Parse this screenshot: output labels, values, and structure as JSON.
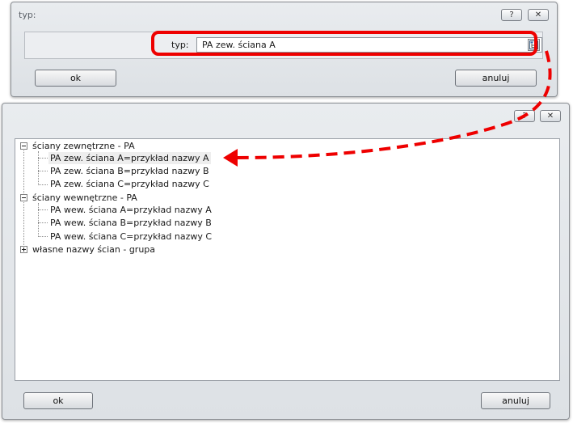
{
  "dialog_type": {
    "title": "typ:",
    "help_glyph": "?",
    "close_glyph": "✕",
    "field_label": "typ:",
    "field_value": "PA zew. ściana A",
    "ok_label": "ok",
    "cancel_label": "anuluj"
  },
  "dialog_tree": {
    "help_glyph": "?",
    "close_glyph": "✕",
    "groups": [
      {
        "label": "ściany zewnętrzne - PA",
        "expanded": true,
        "items": [
          {
            "label": "PA zew. ściana A=przykład nazwy A",
            "selected": true
          },
          {
            "label": "PA zew. ściana B=przykład nazwy B"
          },
          {
            "label": "PA zew. ściana C=przykład nazwy C"
          }
        ]
      },
      {
        "label": "ściany wewnętrzne - PA",
        "expanded": true,
        "items": [
          {
            "label": "PA wew. ściana A=przykład nazwy A"
          },
          {
            "label": "PA wew. ściana B=przykład nazwy B"
          },
          {
            "label": "PA wew. ściana C=przykład nazwy C"
          }
        ]
      },
      {
        "label": "własne nazwy ścian - grupa",
        "expanded": false,
        "items": []
      }
    ],
    "ok_label": "ok",
    "cancel_label": "anuluj"
  },
  "colors": {
    "annotation": "#ee0000",
    "selection": "#eeeeee"
  }
}
